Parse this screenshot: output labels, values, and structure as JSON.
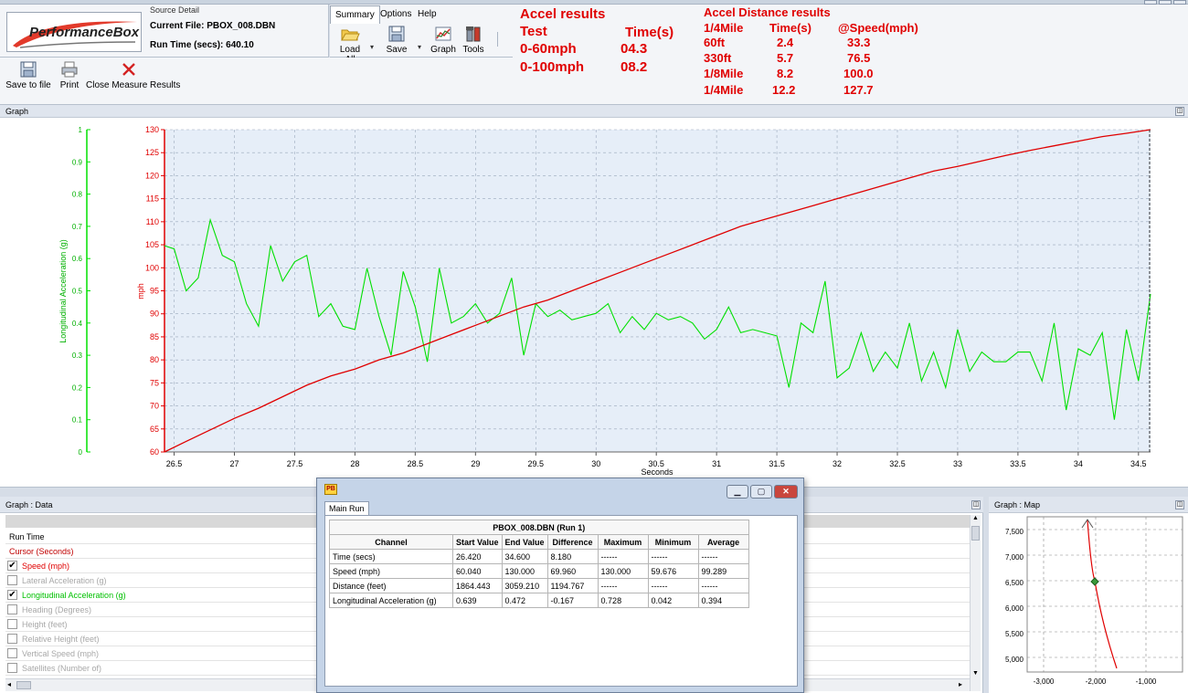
{
  "source": {
    "title": "Source Detail",
    "logo_text": "PerformanceBox",
    "current_file": "Current File: PBOX_008.DBN",
    "run_time": "Run Time (secs): 640.10"
  },
  "ribbon": {
    "tabs": [
      "Summary",
      "Options",
      "Help"
    ],
    "buttons": {
      "load_all": "Load All",
      "save": "Save",
      "graph": "Graph",
      "tools": "Tools"
    }
  },
  "toolbar": {
    "save_to_file": "Save to file",
    "print": "Print",
    "close_measure": "Close Measure Results"
  },
  "accel": {
    "title": "Accel results",
    "test_header": "Test",
    "time_header": "Time(s)",
    "rows": [
      {
        "test": "0-60mph",
        "time": "04.3"
      },
      {
        "test": "0-100mph",
        "time": "08.2"
      }
    ]
  },
  "distance": {
    "title": "Accel Distance results",
    "h1": "1/4Mile",
    "h2": "Time(s)",
    "h3": "@Speed(mph)",
    "rows": [
      {
        "dist": "60ft",
        "time": "2.4",
        "speed": "33.3"
      },
      {
        "dist": "330ft",
        "time": "5.7",
        "speed": "76.5"
      },
      {
        "dist": "1/8Mile",
        "time": "8.2",
        "speed": "100.0"
      },
      {
        "dist": "1/4Mile",
        "time": "12.2",
        "speed": "127.7"
      }
    ]
  },
  "graph": {
    "header": "Graph",
    "left_axis_label": "Longitudinal Acceleration (g)",
    "right_axis_label": "mph",
    "x_label": "Seconds"
  },
  "chart_data": {
    "type": "line",
    "x_range": [
      26.42,
      34.6
    ],
    "xlabel": "Seconds",
    "x_ticks": [
      26.5,
      27,
      27.5,
      28,
      28.5,
      29,
      29.5,
      30,
      30.5,
      31,
      31.5,
      32,
      32.5,
      33,
      33.5,
      34,
      34.5
    ],
    "y_speed_ticks": [
      60,
      65,
      70,
      75,
      80,
      85,
      90,
      95,
      100,
      105,
      110,
      115,
      120,
      125,
      130
    ],
    "y_accel_ticks": [
      0,
      0.1,
      0.2,
      0.3,
      0.4,
      0.5,
      0.6,
      0.7,
      0.8,
      0.9,
      1
    ],
    "colors": {
      "speed": "#e00000",
      "accel": "#00e000",
      "plot_bg": "#e6eef8"
    },
    "series": [
      {
        "name": "mph",
        "axis": "right",
        "x": [
          26.42,
          26.6,
          26.8,
          27.0,
          27.2,
          27.4,
          27.6,
          27.8,
          28.0,
          28.2,
          28.4,
          28.6,
          28.8,
          29.0,
          29.2,
          29.4,
          29.6,
          29.8,
          30.0,
          30.2,
          30.4,
          30.6,
          30.8,
          31.0,
          31.2,
          31.4,
          31.6,
          31.8,
          32.0,
          32.2,
          32.4,
          32.6,
          32.8,
          33.0,
          33.2,
          33.4,
          33.6,
          33.8,
          34.0,
          34.2,
          34.4,
          34.6
        ],
        "values": [
          60.0,
          62.3,
          64.8,
          67.3,
          69.5,
          72.0,
          74.5,
          76.5,
          78.0,
          80.0,
          81.5,
          83.5,
          85.5,
          87.5,
          89.5,
          91.5,
          93.0,
          95.0,
          97.0,
          99.0,
          101.0,
          103.0,
          105.0,
          107.0,
          109.0,
          110.5,
          112.0,
          113.5,
          115.0,
          116.5,
          118.0,
          119.5,
          121.0,
          122.0,
          123.2,
          124.4,
          125.5,
          126.5,
          127.5,
          128.5,
          129.2,
          130.0
        ]
      },
      {
        "name": "Longitudinal Acceleration (g)",
        "axis": "left",
        "x": [
          26.42,
          26.5,
          26.6,
          26.7,
          26.8,
          26.9,
          27.0,
          27.1,
          27.2,
          27.3,
          27.4,
          27.5,
          27.6,
          27.7,
          27.8,
          27.9,
          28.0,
          28.1,
          28.2,
          28.3,
          28.4,
          28.5,
          28.6,
          28.7,
          28.8,
          28.9,
          29.0,
          29.1,
          29.2,
          29.3,
          29.4,
          29.5,
          29.6,
          29.7,
          29.8,
          29.9,
          30.0,
          30.1,
          30.2,
          30.3,
          30.4,
          30.5,
          30.6,
          30.7,
          30.8,
          30.9,
          31.0,
          31.1,
          31.2,
          31.3,
          31.4,
          31.5,
          31.6,
          31.7,
          31.8,
          31.9,
          32.0,
          32.1,
          32.2,
          32.3,
          32.4,
          32.5,
          32.6,
          32.7,
          32.8,
          32.9,
          33.0,
          33.1,
          33.2,
          33.3,
          33.4,
          33.5,
          33.6,
          33.7,
          33.8,
          33.9,
          34.0,
          34.1,
          34.2,
          34.3,
          34.4,
          34.5,
          34.6
        ],
        "values": [
          0.64,
          0.63,
          0.5,
          0.54,
          0.72,
          0.61,
          0.59,
          0.46,
          0.39,
          0.64,
          0.53,
          0.59,
          0.61,
          0.42,
          0.46,
          0.39,
          0.38,
          0.57,
          0.42,
          0.3,
          0.56,
          0.45,
          0.28,
          0.57,
          0.4,
          0.42,
          0.46,
          0.4,
          0.43,
          0.54,
          0.3,
          0.46,
          0.42,
          0.44,
          0.41,
          0.42,
          0.43,
          0.46,
          0.37,
          0.42,
          0.38,
          0.43,
          0.41,
          0.42,
          0.4,
          0.35,
          0.38,
          0.45,
          0.37,
          0.38,
          0.37,
          0.36,
          0.2,
          0.4,
          0.37,
          0.53,
          0.23,
          0.26,
          0.37,
          0.25,
          0.31,
          0.26,
          0.4,
          0.22,
          0.31,
          0.2,
          0.38,
          0.25,
          0.31,
          0.28,
          0.28,
          0.31,
          0.31,
          0.22,
          0.4,
          0.13,
          0.32,
          0.3,
          0.37,
          0.1,
          0.38,
          0.22,
          0.49
        ]
      }
    ]
  },
  "data_panel": {
    "header": "Graph : Data",
    "rows": [
      {
        "label": "Run Time",
        "checkbox": false,
        "checked": false,
        "color": "#000000"
      },
      {
        "label": "Cursor (Seconds)",
        "checkbox": false,
        "checked": false,
        "color": "#c00000"
      },
      {
        "label": "Speed (mph)",
        "checkbox": true,
        "checked": true,
        "color": "#e00000"
      },
      {
        "label": "Lateral Acceleration (g)",
        "checkbox": true,
        "checked": false,
        "color": "#a8a8a8"
      },
      {
        "label": "Longitudinal Acceleration (g)",
        "checkbox": true,
        "checked": true,
        "color": "#00c000"
      },
      {
        "label": "Heading (Degrees)",
        "checkbox": true,
        "checked": false,
        "color": "#a8a8a8"
      },
      {
        "label": "Height (feet)",
        "checkbox": true,
        "checked": false,
        "color": "#a8a8a8"
      },
      {
        "label": "Relative Height (feet)",
        "checkbox": true,
        "checked": false,
        "color": "#a8a8a8"
      },
      {
        "label": "Vertical Speed (mph)",
        "checkbox": true,
        "checked": false,
        "color": "#a8a8a8"
      },
      {
        "label": "Satellites (Number of)",
        "checkbox": true,
        "checked": false,
        "color": "#a8a8a8"
      }
    ]
  },
  "map_panel": {
    "header": "Graph : Map",
    "y_ticks": [
      "7,500",
      "7,000",
      "6,500",
      "6,000",
      "5,500",
      "5,000"
    ],
    "x_ticks": [
      "-3,000",
      "-2,000",
      "-1,000"
    ]
  },
  "dialog": {
    "tab": "Main Run",
    "title": "PBOX_008.DBN (Run 1)",
    "headers": [
      "Channel",
      "Start Value",
      "End Value",
      "Difference",
      "Maximum",
      "Minimum",
      "Average"
    ],
    "rows": [
      [
        "Time (secs)",
        "26.420",
        "34.600",
        "8.180",
        "------",
        "------",
        "------"
      ],
      [
        "Speed (mph)",
        "60.040",
        "130.000",
        "69.960",
        "130.000",
        "59.676",
        "99.289"
      ],
      [
        "Distance (feet)",
        "1864.443",
        "3059.210",
        "1194.767",
        "------",
        "------",
        "------"
      ],
      [
        "Longitudinal Acceleration (g)",
        "0.639",
        "0.472",
        "-0.167",
        "0.728",
        "0.042",
        "0.394"
      ]
    ]
  }
}
